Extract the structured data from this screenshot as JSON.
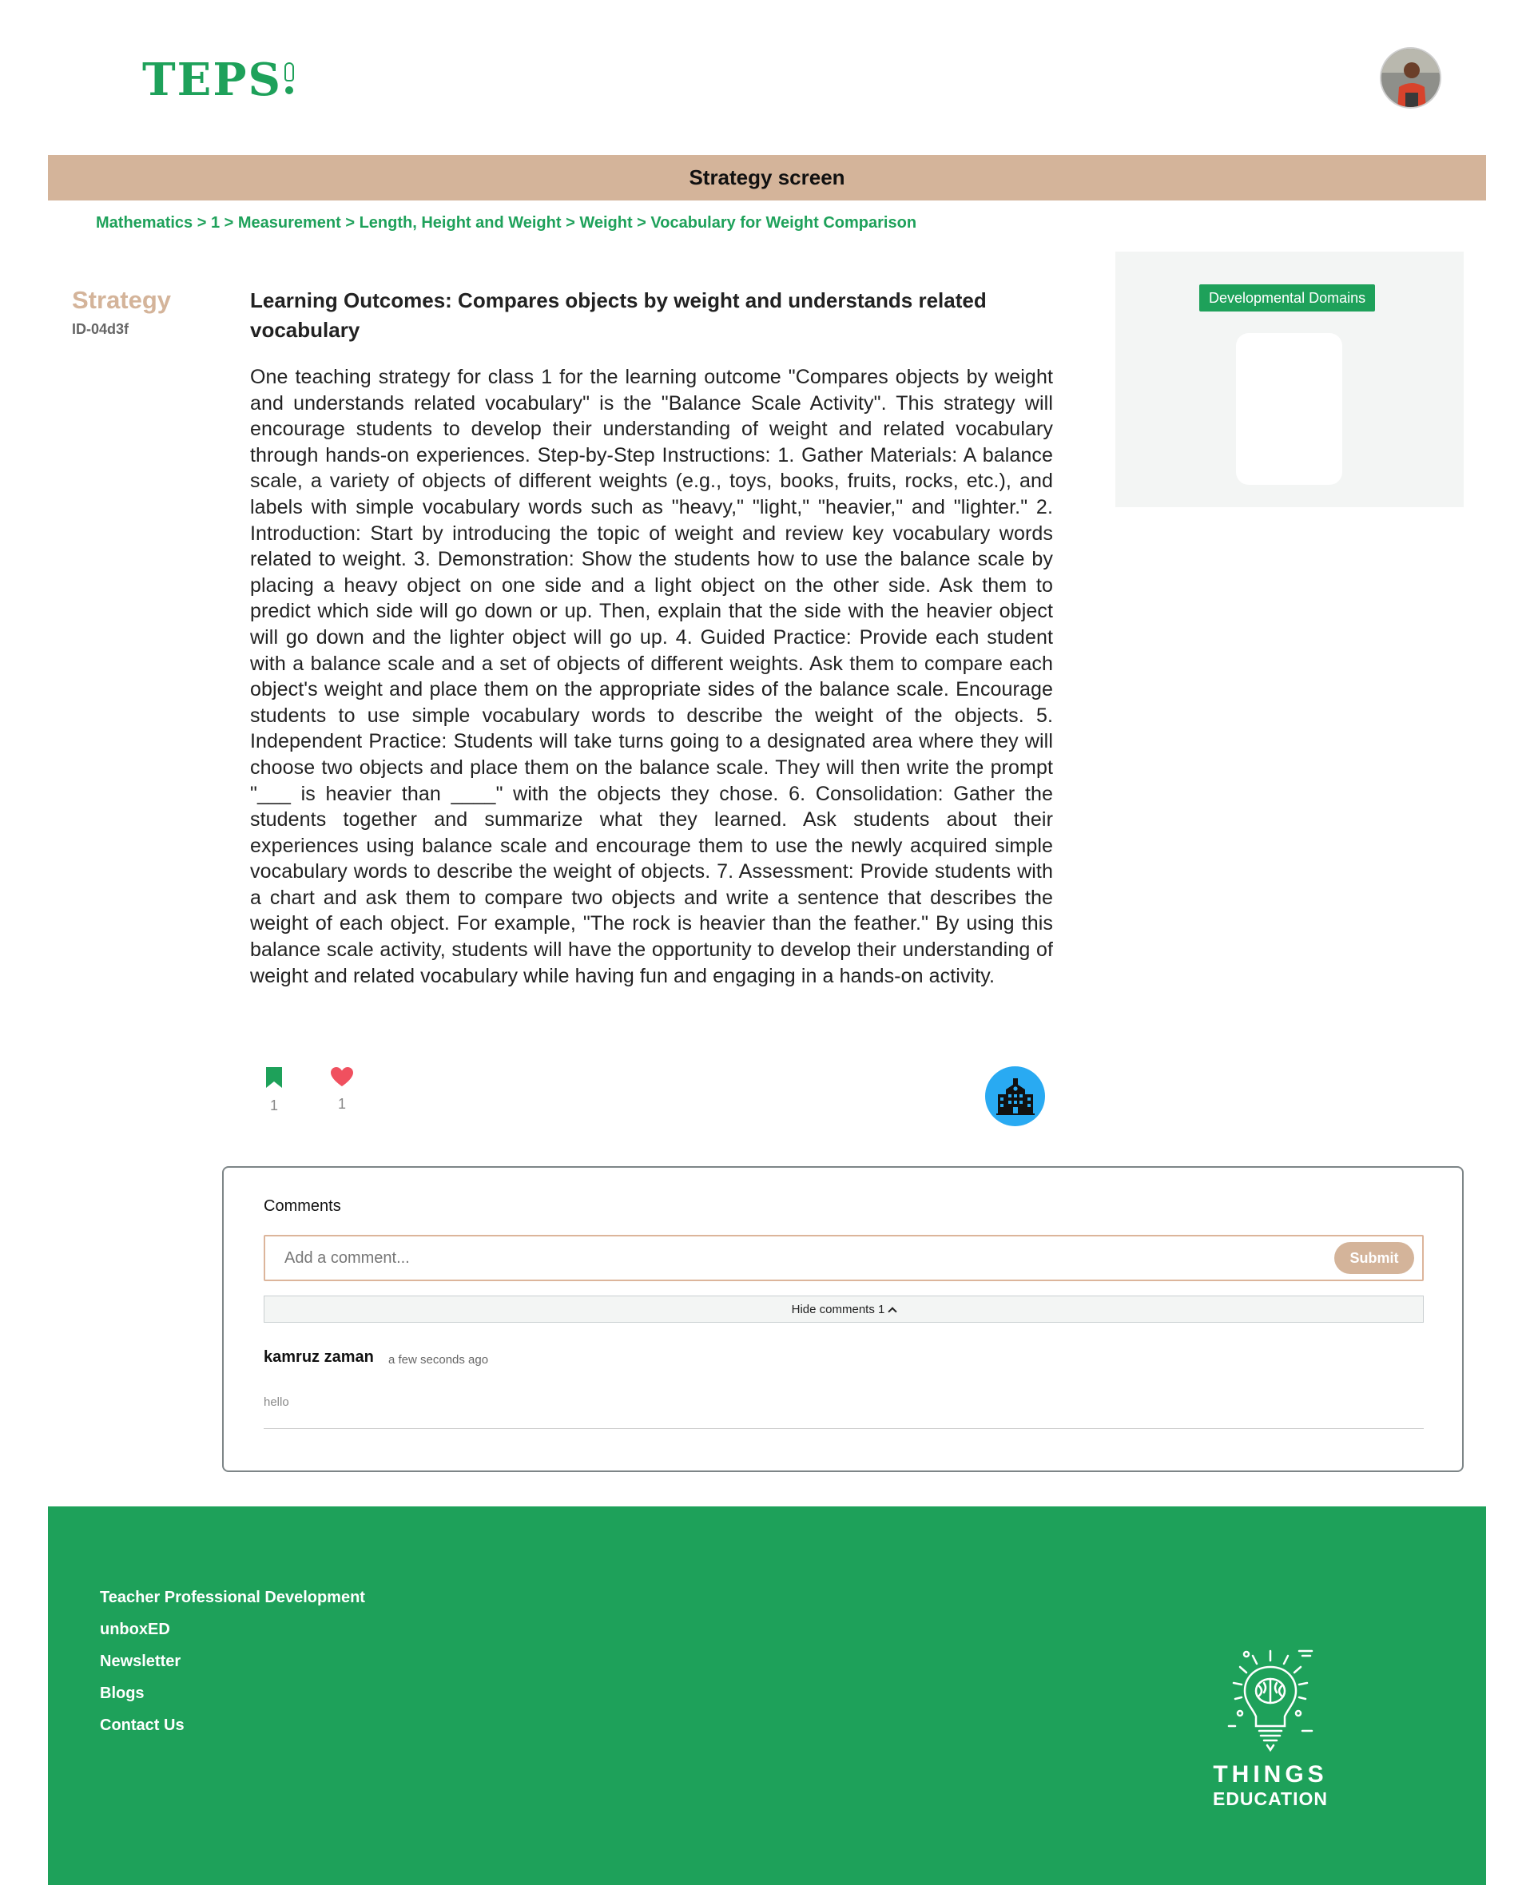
{
  "header": {
    "logo_text": "TEPS",
    "avatar_alt": "user-avatar"
  },
  "page": {
    "title": "Strategy screen",
    "breadcrumb": "Mathematics > 1 > Measurement > Length, Height and Weight > Weight > Vocabulary for Weight Comparison"
  },
  "strategy": {
    "label": "Strategy",
    "id": "ID-04d3f",
    "outcome": "Learning Outcomes: Compares objects by weight and understands related vocabulary",
    "body": "One teaching strategy for class 1 for the learning outcome \"Compares objects by weight and understands related vocabulary\" is the \"Balance Scale Activity\". This strategy will encourage students to develop their understanding of weight and related vocabulary through hands-on experiences. Step-by-Step Instructions: 1. Gather Materials: A balance scale, a variety of objects of different weights (e.g., toys, books, fruits, rocks, etc.), and labels with simple vocabulary words such as \"heavy,\" \"light,\" \"heavier,\" and \"lighter.\" 2. Introduction: Start by introducing the topic of weight and review key vocabulary words related to weight. 3. Demonstration: Show the students how to use the balance scale by placing a heavy object on one side and a light object on the other side. Ask them to predict which side will go down or up. Then, explain that the side with the heavier object will go down and the lighter object will go up. 4. Guided Practice: Provide each student with a balance scale and a set of objects of different weights. Ask them to compare each object's weight and place them on the appropriate sides of the balance scale. Encourage students to use simple vocabulary words to describe the weight of the objects. 5. Independent Practice: Students will take turns going to a designated area where they will choose two objects and place them on the balance scale. They will then write the prompt \"___ is heavier than ____\" with the objects they chose. 6. Consolidation: Gather the students together and summarize what they learned. Ask students about their experiences using balance scale and encourage them to use the newly acquired simple vocabulary words to describe the weight of objects. 7. Assessment: Provide students with a chart and ask them to compare two objects and write a sentence that describes the weight of each object. For example, \"The rock is heavier than the feather.\" By using this balance scale activity, students will have the opportunity to develop their understanding of weight and related vocabulary while having fun and engaging in a hands-on activity.",
    "bookmark_count": "1",
    "like_count": "1"
  },
  "side_panel": {
    "badge": "Developmental Domains"
  },
  "comments": {
    "title": "Comments",
    "placeholder": "Add a comment...",
    "submit_label": "Submit",
    "hide_label": "Hide comments 1",
    "items": [
      {
        "author": "kamruz zaman",
        "time": "a few seconds ago",
        "text": "hello"
      }
    ]
  },
  "footer": {
    "links": [
      "Teacher Professional Development",
      "unboxED",
      "Newsletter",
      "Blogs",
      "Contact Us"
    ],
    "logo_line1": "THINGS",
    "logo_line2": "EDUCATION"
  },
  "colors": {
    "brand_green": "#1ea15a",
    "tan": "#d4b49a",
    "school_blue": "#29aaf2",
    "like_red": "#f0505f"
  }
}
